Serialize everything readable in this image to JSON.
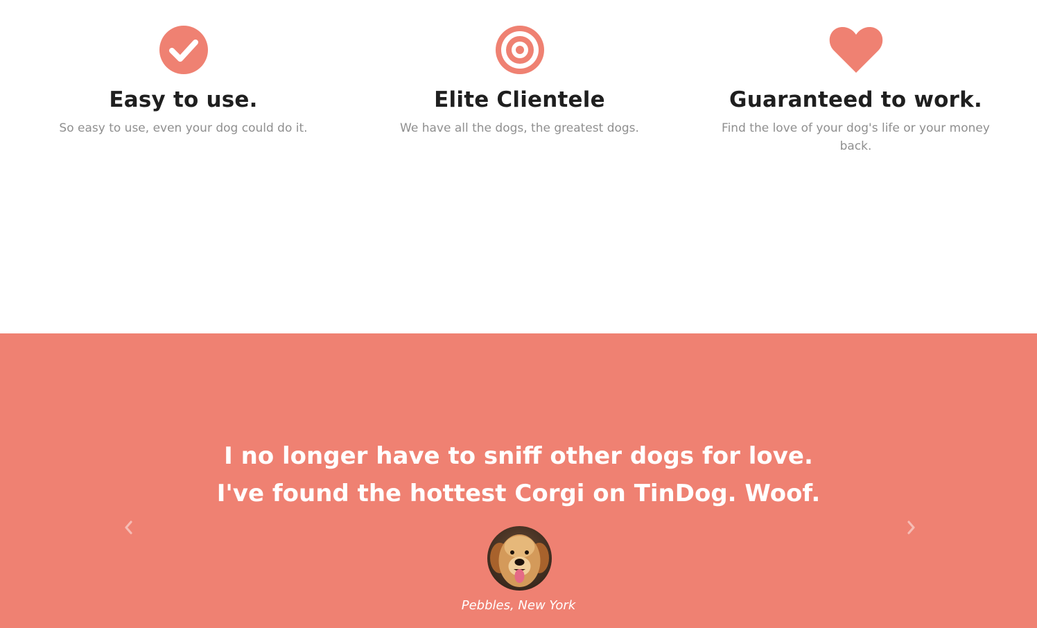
{
  "features": [
    {
      "icon": "check-circle-icon",
      "title": "Easy to use.",
      "text": "So easy to use, even your dog could do it."
    },
    {
      "icon": "bullseye-icon",
      "title": "Elite Clientele",
      "text": "We have all the dogs, the greatest dogs."
    },
    {
      "icon": "heart-icon",
      "title": "Guaranteed to work.",
      "text": "Find the love of your dog's life or your money back."
    }
  ],
  "testimonial": {
    "quote_line1": "I no longer have to sniff other dogs for love.",
    "quote_line2": "I've found the hottest Corgi on TinDog. Woof.",
    "author": "Pebbles, New York",
    "avatar_icon": "dog-avatar"
  },
  "carousel": {
    "prev_icon": "chevron-left-icon",
    "next_icon": "chevron-right-icon"
  },
  "colors": {
    "accent": "#ef8172",
    "heading": "#1f1f1f",
    "body_text": "#8f8f8f",
    "white": "#ffffff"
  }
}
